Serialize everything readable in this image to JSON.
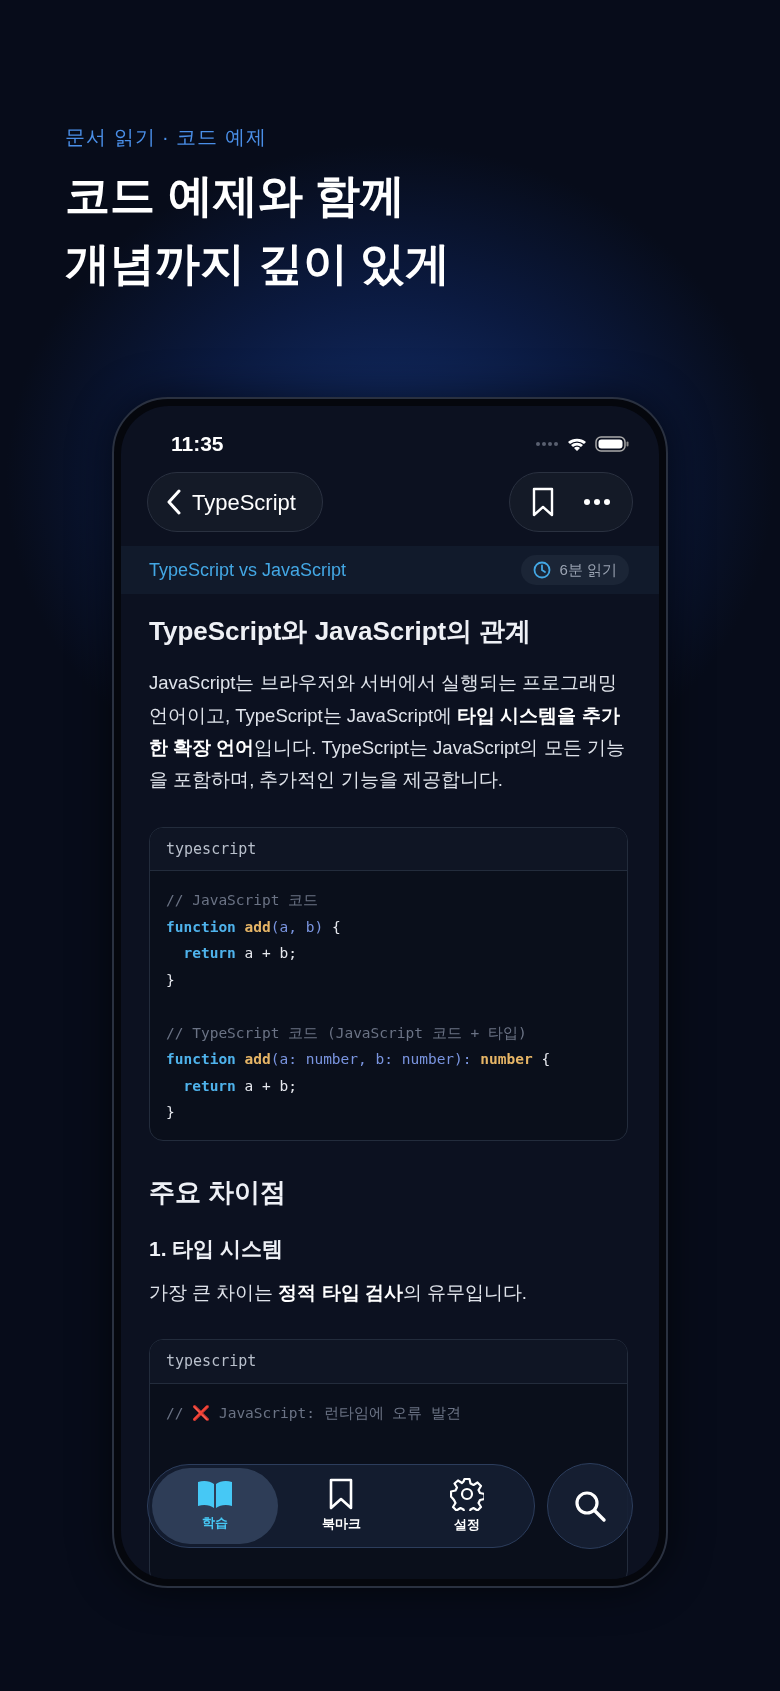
{
  "eyebrow": "문서 읽기 · 코드 예제",
  "headline": [
    "코드 예제와 함께",
    "개념까지 깊이 있게"
  ],
  "status_bar": {
    "time": "11:35"
  },
  "nav": {
    "back_label": "TypeScript"
  },
  "subheader": {
    "topic": "TypeScript vs JavaScript",
    "read_time": "6분 읽기"
  },
  "article": [
    {
      "kind": "h1",
      "text": "TypeScript와 JavaScript의 관계"
    },
    {
      "kind": "p",
      "text": "JavaScript는 브라우저와 서버에서 실행되는 프로그래밍 언어이고, TypeScript는 JavaScript에 **타입 시스템을 추가한 확장 언어**입니다. TypeScript는 JavaScript의 모든 기능을 포함하며, 추가적인 기능을 제공합니다."
    },
    {
      "kind": "code",
      "language": "typescript",
      "lines": [
        {
          "tokens": [
            {
              "kind": "comment",
              "text": "// JavaScript 코드"
            }
          ]
        },
        {
          "tokens": [
            {
              "kind": "keyword",
              "text": "function"
            },
            {
              "kind": "func",
              "text": " add"
            },
            {
              "kind": "param",
              "text": "(a, b)"
            },
            {
              "kind": "plain",
              "text": " {"
            }
          ]
        },
        {
          "indented": true,
          "tokens": [
            {
              "kind": "keyword",
              "text": "return"
            },
            {
              "kind": "plain",
              "text": " a + b;"
            }
          ]
        },
        {
          "tokens": [
            {
              "kind": "plain",
              "text": "}"
            }
          ]
        },
        {
          "blank_line_before": true,
          "tokens": [
            {
              "kind": "comment",
              "text": "// TypeScript 코드 (JavaScript 코드 + 타입)"
            }
          ]
        },
        {
          "tokens": [
            {
              "kind": "keyword",
              "text": "function"
            },
            {
              "kind": "func",
              "text": " add"
            },
            {
              "kind": "param",
              "text": "(a: number, b: number):"
            },
            {
              "kind": "type",
              "text": " number"
            },
            {
              "kind": "plain",
              "text": " {"
            }
          ]
        },
        {
          "indented": true,
          "tokens": [
            {
              "kind": "keyword",
              "text": "return"
            },
            {
              "kind": "plain",
              "text": " a + b;"
            }
          ]
        },
        {
          "tokens": [
            {
              "kind": "plain",
              "text": "}"
            }
          ]
        }
      ]
    },
    {
      "kind": "h2",
      "text": "주요 차이점"
    },
    {
      "kind": "h3",
      "text": "1. 타입 시스템"
    },
    {
      "kind": "p",
      "text": "가장 큰 차이는 **정적 타입 검사**의 유무입니다."
    },
    {
      "kind": "code",
      "language": "typescript",
      "lines": [
        {
          "tokens": [
            {
              "kind": "comment",
              "text": "// "
            },
            {
              "kind": "mark",
              "text": "❌"
            },
            {
              "kind": "comment",
              "text": " JavaScript: 런타임에 오류 발견"
            }
          ]
        }
      ]
    }
  ],
  "tab_bar": [
    {
      "label": "학습",
      "selected": true
    },
    {
      "label": "북마크",
      "selected": false
    },
    {
      "label": "설정",
      "selected": false
    }
  ]
}
